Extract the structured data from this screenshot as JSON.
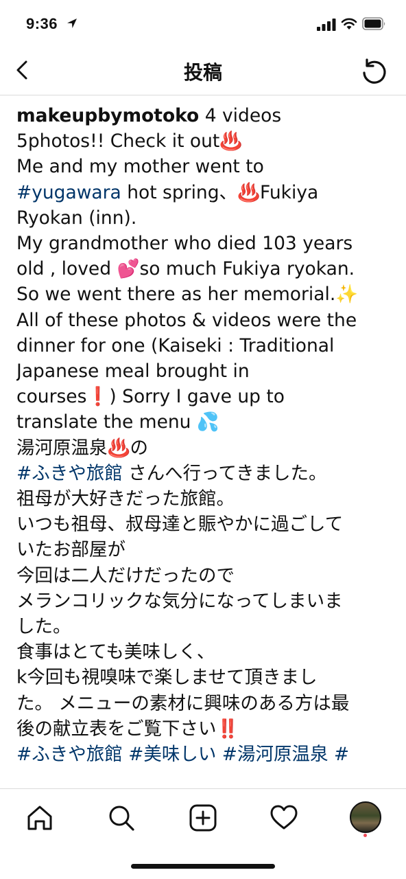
{
  "status_bar": {
    "time": "9:36",
    "icons": [
      "location-arrow-icon",
      "signal-icon",
      "wifi-icon",
      "battery-icon"
    ]
  },
  "nav": {
    "title": "投稿",
    "back_icon": "chevron-left-icon",
    "refresh_icon": "refresh-icon"
  },
  "post": {
    "username": "makeupbymotoko",
    "lines": [
      [
        {
          "t": " 4 videos"
        }
      ],
      [
        {
          "t": "5photos!! Check it out♨️"
        }
      ],
      [
        {
          "t": "Me and my mother went to"
        }
      ],
      [
        {
          "t": "#yugawara",
          "tag": true
        },
        {
          "t": " hot spring、♨️Fukiya"
        }
      ],
      [
        {
          "t": "Ryokan (inn)."
        }
      ],
      [
        {
          "t": "My grandmother who died 103 years"
        }
      ],
      [
        {
          "t": "old , loved 💕so much Fukiya ryokan."
        }
      ],
      [
        {
          "t": "So we went there as her memorial.✨"
        }
      ],
      [
        {
          "t": "All of these photos & videos were the"
        }
      ],
      [
        {
          "t": "dinner for one (Kaiseki : Traditional"
        }
      ],
      [
        {
          "t": "Japanese meal brought in"
        }
      ],
      [
        {
          "t": "courses❗️) Sorry I gave up to"
        }
      ],
      [
        {
          "t": "translate the menu 💦"
        }
      ],
      [
        {
          "t": "湯河原温泉♨️の"
        }
      ],
      [
        {
          "t": "#ふきや旅館",
          "tag": true
        },
        {
          "t": " さんへ行ってきました。"
        }
      ],
      [
        {
          "t": "祖母が大好きだった旅館。"
        }
      ],
      [
        {
          "t": "いつも祖母、叔母達と賑やかに過ごして"
        }
      ],
      [
        {
          "t": "いたお部屋が"
        }
      ],
      [
        {
          "t": "今回は二人だけだったので"
        }
      ],
      [
        {
          "t": "メランコリックな気分になってしまいま"
        }
      ],
      [
        {
          "t": "した。"
        }
      ],
      [
        {
          "t": "食事はとても美味しく、"
        }
      ],
      [
        {
          "t": "k今回も視嗅味で楽しませて頂きまし"
        }
      ],
      [
        {
          "t": "た。 メニューの素材に興味のある方は最"
        }
      ],
      [
        {
          "t": "後の献立表をご覧下さい‼️"
        }
      ],
      [
        {
          "t": "#ふきや旅館 #美味しい #湯河原温泉 #",
          "tag": true
        }
      ]
    ]
  },
  "tab_bar": {
    "items": [
      {
        "name": "home-icon"
      },
      {
        "name": "search-icon"
      },
      {
        "name": "add-post-icon"
      },
      {
        "name": "heart-icon"
      },
      {
        "name": "profile-avatar"
      }
    ],
    "notification_dot_color": "#ed4956"
  },
  "colors": {
    "hashtag": "#003569",
    "text": "#111111",
    "divider": "#dbdbdb"
  }
}
